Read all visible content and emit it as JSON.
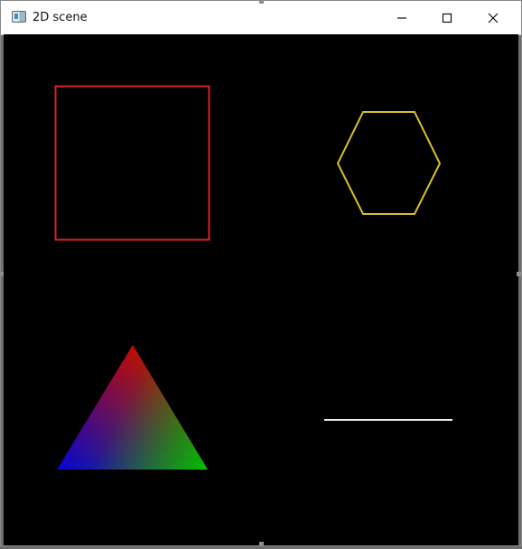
{
  "window": {
    "title": "2D scene"
  },
  "titlebar_icons": {
    "app": "application-icon",
    "minimize": "minimize-icon",
    "maximize": "maximize-icon",
    "close": "close-icon"
  },
  "scene": {
    "background_color": "#000000",
    "shapes": [
      {
        "kind": "square",
        "color": "#d91f26"
      },
      {
        "kind": "hexagon",
        "color": "#d6c12a"
      },
      {
        "kind": "triangle",
        "vertex_colors": [
          "#d00000",
          "#0000d8",
          "#00c000"
        ]
      },
      {
        "kind": "line",
        "color": "#f0f0f0"
      }
    ]
  }
}
